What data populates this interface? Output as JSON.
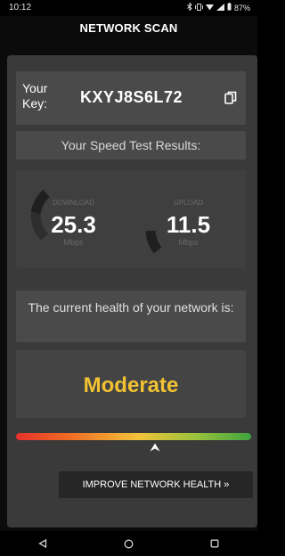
{
  "status_bar": {
    "time": "10:12",
    "battery": "87%"
  },
  "app_bar": {
    "title": "NETWORK SCAN"
  },
  "key_panel": {
    "label": "Your Key:",
    "value": "KXYJ8S6L72",
    "copy_icon": "copy-icon"
  },
  "results": {
    "title": "Your Speed Test Results:"
  },
  "download": {
    "title": "DOWNLOAD",
    "value": "25.3",
    "unit": "Mbps"
  },
  "upload": {
    "title": "UPLOAD",
    "value": "11.5",
    "unit": "Mbps"
  },
  "health": {
    "prompt": "The current health of your network is:",
    "status": "Moderate",
    "status_color": "#f2c232",
    "marker_position": 0.59
  },
  "improve_button": {
    "label": "IMPROVE NETWORK HEALTH »"
  },
  "nav": {
    "back_icon": "back-triangle-icon",
    "home_icon": "home-circle-icon",
    "recents_icon": "recents-square-icon"
  },
  "colors": {
    "background": "#0b0b0b",
    "card": "#3a3a3a",
    "panel": "#4a4a4a",
    "accent_yellow": "#f2c232",
    "bar_red": "#e5312c",
    "bar_orange": "#ef6a24",
    "bar_green": "#3ea33f"
  }
}
